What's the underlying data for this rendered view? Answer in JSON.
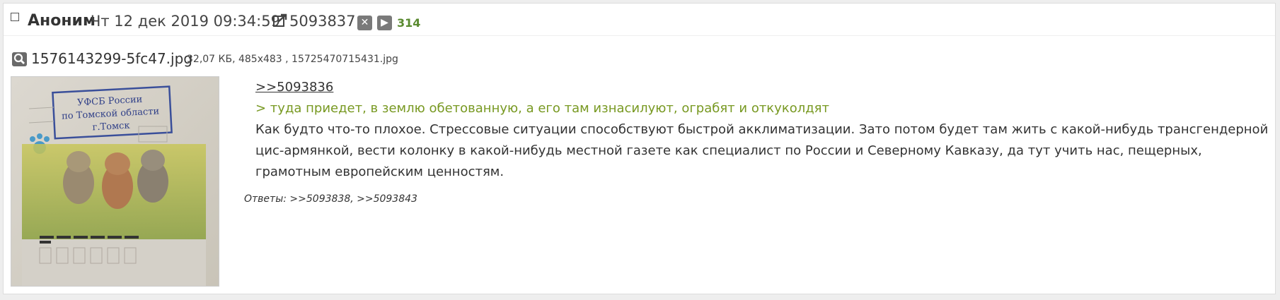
{
  "header": {
    "author": "Аноним",
    "date": "Чт 12 дек 2019 09:34:59",
    "post_number": "5093837",
    "counter": "314",
    "hide_icon": "close-icon",
    "play_icon": "play-icon",
    "reply_icon": "share-icon"
  },
  "file": {
    "icon": "search-icon",
    "name": "1576143299-5fc47.jpg",
    "info": "32,07 КБ, 485x483 , 15725470715431.jpg",
    "thumb": {
      "stamp_line1": "УФСБ России",
      "stamp_line2": "по Томской области",
      "stamp_line3": "г.Томск"
    }
  },
  "body": {
    "reply_link": ">>5093836",
    "quote": "> туда приедет, в землю обетованную, а его там изнасилуют, ограбят и откуколдят",
    "message": "Как будто что-то плохое. Стрессовые ситуации способствуют быстрой акклиматизации. Зато потом будет там жить с какой-нибудь трансгендерной цис-армянкой, вести колонку в какой-нибудь местной газете как специалист по России и Северному Кавказу, да тут учить нас, пещерных, грамотным европейским ценностям."
  },
  "replies": {
    "text": "Ответы: >>5093838, >>5093843"
  },
  "colors": {
    "quote": "#789922",
    "counter": "#5a8a30"
  }
}
